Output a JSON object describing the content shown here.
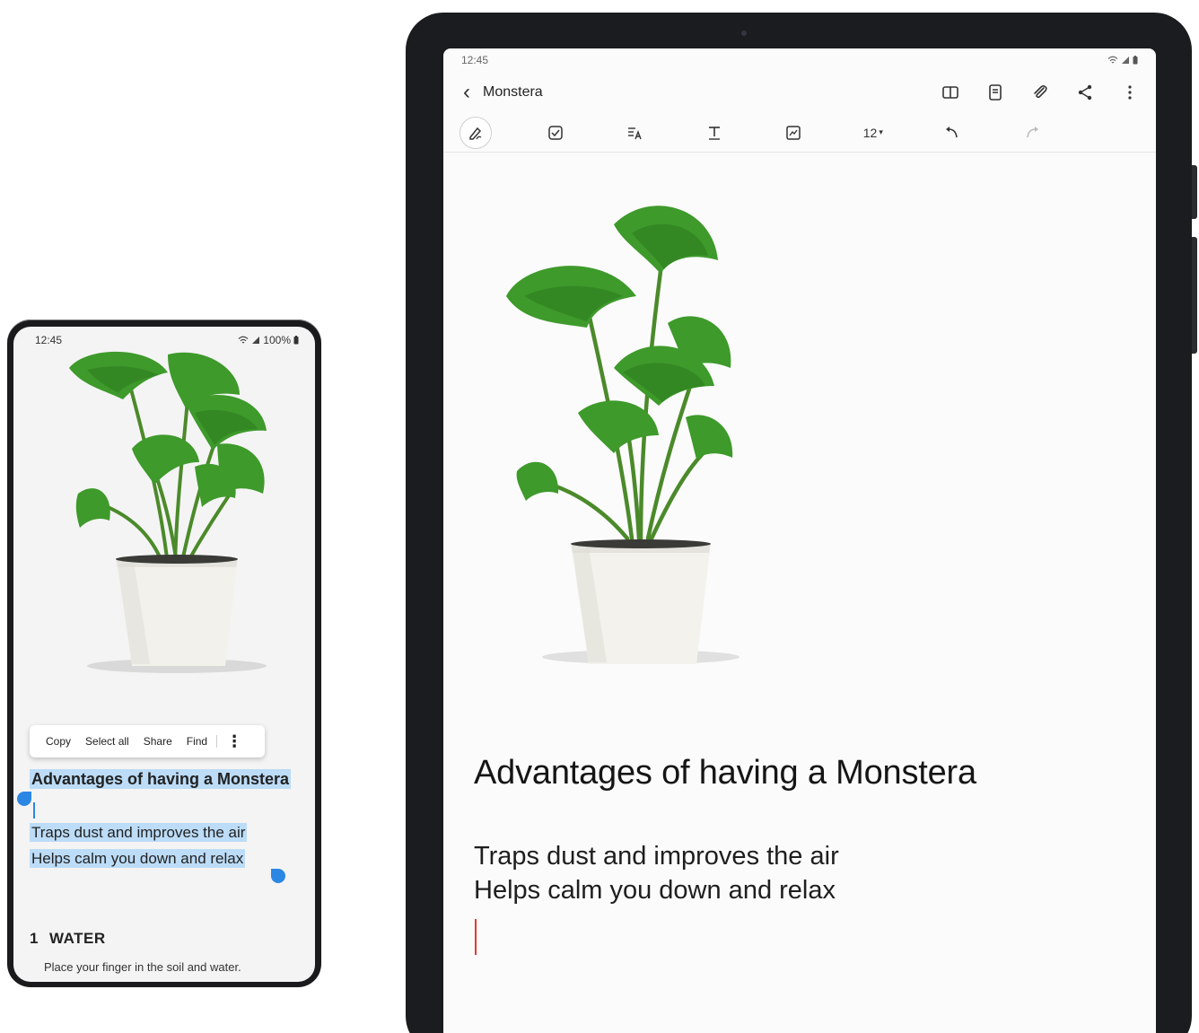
{
  "phone": {
    "status": {
      "time": "12:45",
      "battery": "100%"
    },
    "selection_toolbar": {
      "copy": "Copy",
      "select_all": "Select all",
      "share": "Share",
      "find": "Find"
    },
    "note": {
      "title": "Advantages of having a Monstera",
      "lines": [
        "Traps dust and improves the air",
        "Helps calm you down and relax"
      ],
      "section_number": "1",
      "section_title": "WATER",
      "section_text": "Place your finger in the soil and water."
    },
    "selection_color": "#bcdcf7",
    "handle_color": "#2b87e3"
  },
  "tablet": {
    "status": {
      "time": "12:45"
    },
    "appbar": {
      "title": "Monstera",
      "actions": [
        "book-icon",
        "page-icon",
        "attach-icon",
        "share-icon",
        "more-icon"
      ]
    },
    "toolbar": {
      "font_size": "12",
      "tools": [
        "pen-icon",
        "checkbox-icon",
        "text-style-icon",
        "text-format-icon",
        "image-icon",
        "undo-icon",
        "redo-icon"
      ]
    },
    "note": {
      "heading": "Advantages of having a Monstera",
      "lines": [
        "Traps dust and improves the air",
        "Helps calm you down and relax"
      ]
    },
    "cursor_color": "#e23b2e"
  }
}
